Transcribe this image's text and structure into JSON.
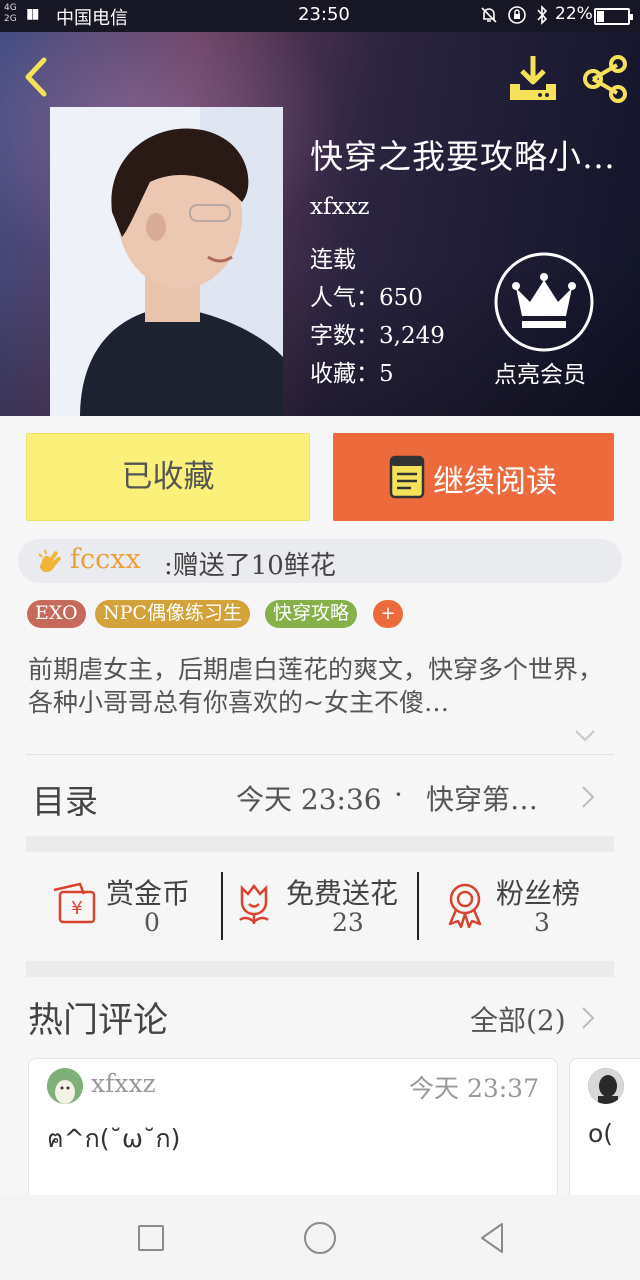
{
  "status_bar": {
    "network_top": "4G",
    "network_bottom": "2G",
    "carrier": "中国电信",
    "time": "23:50",
    "battery": "22%"
  },
  "book": {
    "title": "快穿之我要攻略小…",
    "author": "xfxxz",
    "status": "连载",
    "popularity": "人气：650",
    "word_count": "字数：3,249",
    "favorites": "收藏：5",
    "description": "前期虐女主，后期虐白莲花的爽文，快穿多个世界，各种小哥哥总有你喜欢的~女主不傻…"
  },
  "vip": {
    "label": "点亮会员"
  },
  "actions": {
    "favorited_label": "已收藏",
    "continue_label": "继续阅读"
  },
  "gift_notice": {
    "user": "fccxx",
    "message": ":赠送了10鲜花"
  },
  "tags": [
    {
      "label": "EXO",
      "color": "#c66b5c"
    },
    {
      "label": "NPC偶像练习生",
      "color": "#d4a23a"
    },
    {
      "label": "快穿攻略",
      "color": "#86b04a"
    }
  ],
  "tag_add_label": "+",
  "catalog": {
    "title": "目录",
    "update_time": "今天 23:36",
    "separator": "·",
    "latest_chapter": "快穿第…"
  },
  "stats": [
    {
      "label": "赏金币",
      "value": "0",
      "icon": "red-envelope-icon"
    },
    {
      "label": "免费送花",
      "value": "23",
      "icon": "flower-icon"
    },
    {
      "label": "粉丝榜",
      "value": "3",
      "icon": "medal-icon"
    }
  ],
  "comments": {
    "title": "热门评论",
    "all_label": "全部(2)",
    "items": [
      {
        "user": "xfxxz",
        "time": "今天 23:37",
        "text": "ฅ^ก(˘ω˘ก)"
      },
      {
        "text": "o("
      }
    ]
  },
  "colors": {
    "accent_orange": "#ec6a3c",
    "favorite_yellow": "#fbf17a",
    "gift_user": "#e7a03d",
    "icon_yellow": "#f5e15a",
    "stat_red": "#d9432e"
  }
}
